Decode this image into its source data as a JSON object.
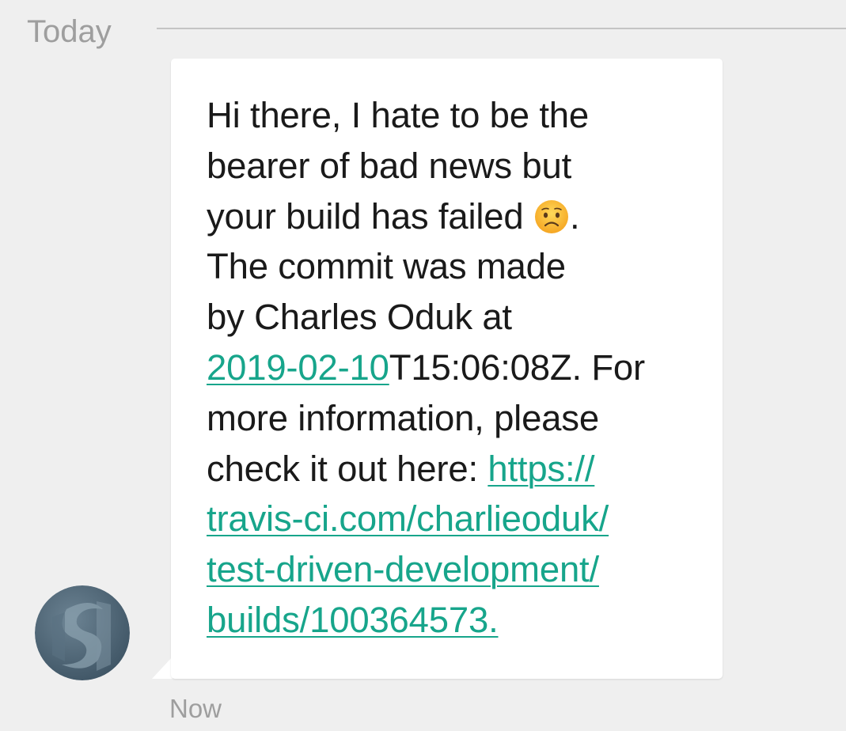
{
  "conversation": {
    "date_divider": "Today",
    "timestamp": "Now"
  },
  "message": {
    "line1": "Hi there, I hate to be the",
    "line2": "bearer of bad news but",
    "line3_text": "your build has failed ",
    "line3_emoji_icon": "frowning-face-emoji",
    "line3_end": ".",
    "line4": "The commit was made",
    "line5": "by Charles Oduk at",
    "line6_link": "2019-02-10",
    "line6_text": "T15:06:08Z. For",
    "line7": "more information, please",
    "line8_text": "check it out here: ",
    "line8_link": "https://",
    "line9_link": "travis-ci.com/charlieoduk/",
    "line10_link": "test-driven-development/",
    "line11_link": "builds/100364573."
  },
  "sender": {
    "avatar_icon": "app-logo-avatar-icon"
  },
  "colors": {
    "background": "#efefef",
    "bubble": "#ffffff",
    "link": "#17a58b",
    "muted_text": "#9e9e9e",
    "avatar": "#4f6778"
  }
}
